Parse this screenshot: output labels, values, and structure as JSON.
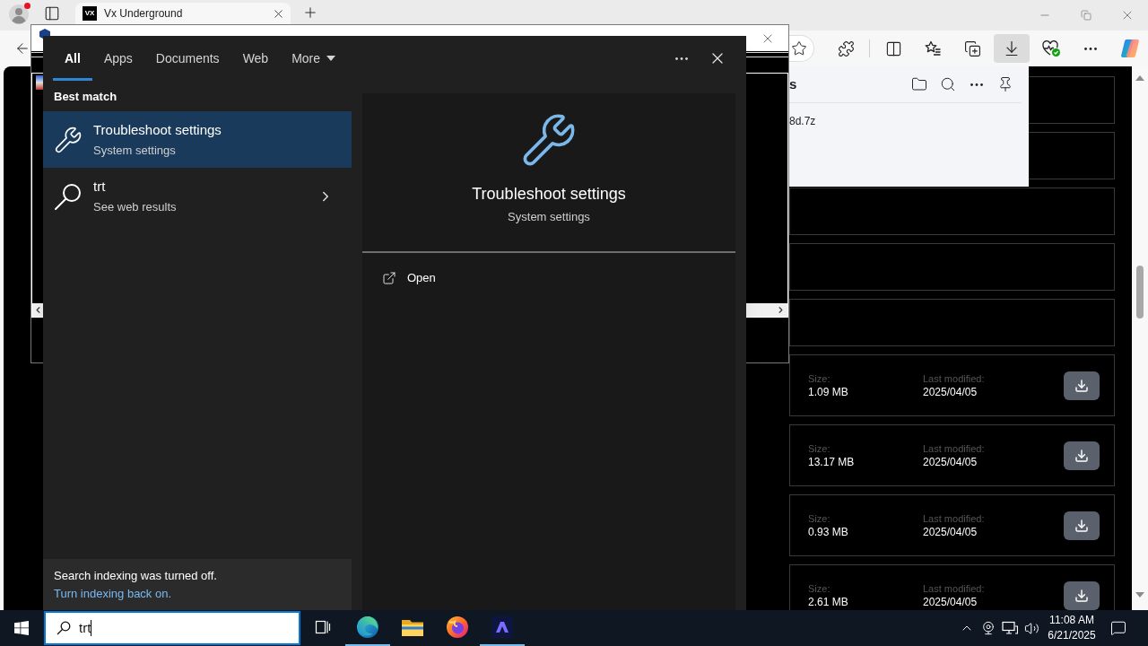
{
  "browser": {
    "tabs": [
      {
        "favicon": "VX",
        "title": "Vx Underground",
        "selected": true
      }
    ],
    "toolbar_buttons": [
      {
        "kind": "extensions",
        "active": false
      },
      {
        "kind": "split-screen",
        "active": false
      },
      {
        "kind": "favorites",
        "active": false
      },
      {
        "kind": "collections",
        "active": false
      },
      {
        "kind": "downloads",
        "active": true
      },
      {
        "kind": "essentials",
        "active": false
      },
      {
        "kind": "more",
        "active": false
      },
      {
        "kind": "copilot",
        "active": false
      }
    ]
  },
  "downloads_panel": {
    "title": "s",
    "file": "8d.7z"
  },
  "page": {
    "entries": [
      {
        "kind": "blank"
      },
      {
        "kind": "blank"
      },
      {
        "kind": "blank"
      },
      {
        "kind": "blank"
      },
      {
        "kind": "blank"
      },
      {
        "kind": "file",
        "size_label": "Size:",
        "size": "1.09 MB",
        "modified_label": "Last modified:",
        "modified": "2025/04/05"
      },
      {
        "kind": "file",
        "size_label": "Size:",
        "size": "13.17 MB",
        "modified_label": "Last modified:",
        "modified": "2025/04/05"
      },
      {
        "kind": "file",
        "size_label": "Size:",
        "size": "0.93 MB",
        "modified_label": "Last modified:",
        "modified": "2025/04/05"
      },
      {
        "kind": "file",
        "size_label": "Size:",
        "size": "2.61 MB",
        "modified_label": "Last modified:",
        "modified": "2025/04/05"
      }
    ]
  },
  "search": {
    "tabs": [
      {
        "kind": "filter",
        "label": "All",
        "selected": true
      },
      {
        "kind": "filter",
        "label": "Apps",
        "selected": false
      },
      {
        "kind": "filter",
        "label": "Documents",
        "selected": false
      },
      {
        "kind": "filter",
        "label": "Web",
        "selected": false
      },
      {
        "kind": "menu",
        "label": "More",
        "selected": false
      }
    ],
    "section_title": "Best match",
    "results": [
      {
        "kind": "setting",
        "title": "Troubleshoot settings",
        "subtitle": "System settings",
        "selected": true
      },
      {
        "kind": "web",
        "title": "trt",
        "subtitle": "See web results",
        "selected": false
      }
    ],
    "preview": {
      "title": "Troubleshoot settings",
      "subtitle": "System settings",
      "actions": [
        {
          "label": "Open"
        }
      ]
    },
    "notice": {
      "text": "Search indexing was turned off.",
      "link": "Turn indexing back on."
    }
  },
  "taskbar": {
    "search": {
      "value": "trt"
    },
    "apps": [
      {
        "kind": "task-view",
        "running": false
      },
      {
        "kind": "edge",
        "running": true
      },
      {
        "kind": "explorer",
        "running": false
      },
      {
        "kind": "firefox",
        "running": false
      },
      {
        "kind": "terminal",
        "running": true
      }
    ],
    "clock": {
      "time": "11:08 AM",
      "date": "6/21/2025"
    }
  }
}
